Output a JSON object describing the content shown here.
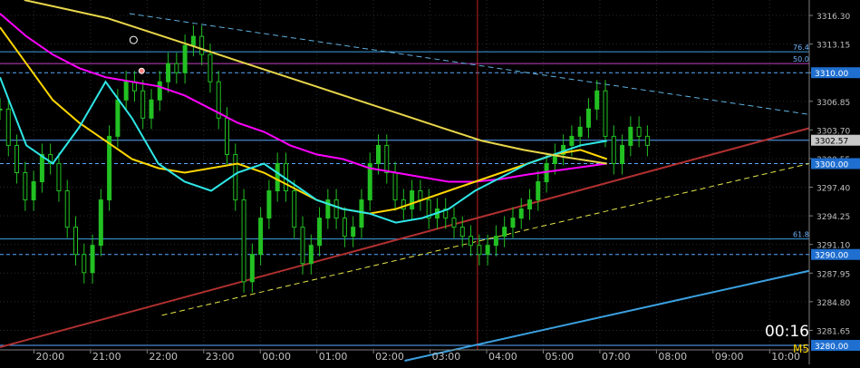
{
  "chart_data": {
    "type": "candlestick",
    "title": "",
    "xlabel": "",
    "ylabel": "",
    "x_ticks": [
      "20:00",
      "21:00",
      "22:00",
      "23:00",
      "00:00",
      "01:00",
      "02:00",
      "03:00",
      "04:00",
      "05:00",
      "07:00",
      "08:00",
      "09:00",
      "10:00"
    ],
    "y_ticks": [
      "3316.30",
      "3313.15",
      "3310.00",
      "3306.85",
      "3303.70",
      "3300.55",
      "3297.40",
      "3294.25",
      "3291.10",
      "3287.95",
      "3284.80",
      "3281.65"
    ],
    "ylim": [
      3279.5,
      3318.0
    ],
    "price_boxes": [
      {
        "label": "3310.00",
        "value": 3310.0
      },
      {
        "label": "3302.57",
        "value": 3302.57
      },
      {
        "label": "3300.00",
        "value": 3300.0
      },
      {
        "label": "3290.00",
        "value": 3290.0
      },
      {
        "label": "3280.00",
        "value": 3280.0
      }
    ],
    "fib_levels": [
      {
        "label": "76.4",
        "value": 3312.3
      },
      {
        "label": "50.0",
        "value": 3311.0
      },
      {
        "label": "61.8",
        "value": 3291.7
      }
    ],
    "close_series": [
      3306,
      3302,
      3299,
      3296,
      3298,
      3301,
      3300,
      3297,
      3293,
      3290,
      3288,
      3291,
      3296,
      3303,
      3307,
      3309,
      3308,
      3305,
      3307,
      3309,
      3311,
      3310,
      3313,
      3314,
      3312,
      3309,
      3305,
      3301,
      3296,
      3287,
      3290,
      3294,
      3297,
      3300,
      3297,
      3293,
      3289,
      3291,
      3294,
      3296,
      3294,
      3292,
      3293,
      3296,
      3300,
      3302,
      3299,
      3296,
      3295,
      3297,
      3296,
      3294,
      3295,
      3294,
      3293,
      3292,
      3291,
      3290,
      3291,
      3292,
      3293,
      3294,
      3295,
      3296,
      3298,
      3300,
      3301,
      3302,
      3303,
      3304,
      3306,
      3308,
      3303,
      3300,
      3302,
      3304,
      3303,
      3302
    ],
    "ma_series": [
      {
        "color": "#ff00ff",
        "values": [
          3316.5,
          3314,
          3312,
          3310.5,
          3309.5,
          3309,
          3308.5,
          3307.5,
          3306,
          3304.5,
          3303.5,
          3302,
          3301,
          3300.5,
          3299.5,
          3299,
          3298.5,
          3298,
          3298,
          3298.3,
          3298.8,
          3299.2,
          3299.6,
          3300
        ]
      },
      {
        "color": "#ffd700",
        "values": [
          3315,
          3311,
          3307,
          3304.5,
          3302.5,
          3300.5,
          3299.5,
          3299,
          3299.5,
          3300,
          3299,
          3297.5,
          3296,
          3295,
          3294.5,
          3295,
          3296,
          3297,
          3298,
          3299,
          3300,
          3301,
          3301.5,
          3300.5
        ]
      },
      {
        "color": "#2ee6e6",
        "values": [
          3309.5,
          3302,
          3300,
          3304,
          3309,
          3305,
          3300,
          3298,
          3297,
          3299,
          3300,
          3298,
          3296,
          3295,
          3294.5,
          3293.5,
          3294,
          3295,
          3297,
          3298.5,
          3300,
          3301,
          3302,
          3302.5
        ]
      },
      {
        "color": "#e8d64a",
        "values": [
          3318,
          3317,
          3316,
          3314.5,
          3313,
          3311.5,
          3310,
          3308.5,
          3307,
          3305.5,
          3304,
          3302.5,
          3301.5,
          3300.7,
          3300
        ]
      }
    ],
    "trendlines": [
      {
        "color": "#b03030",
        "from": {
          "x": 0,
          "y": 3279.8
        },
        "to": {
          "x": 1,
          "y": 3303.9
        }
      },
      {
        "color": "#3aa0e0",
        "from": {
          "x": 0.5,
          "y": 3278.3
        },
        "to": {
          "x": 1,
          "y": 3288.2
        }
      },
      {
        "color": "#e6e64a",
        "from": {
          "x": 0.2,
          "y": 3283.3
        },
        "to": {
          "x": 1,
          "y": 3300.0
        }
      },
      {
        "color": "#60b0e0",
        "from": {
          "x": 0.16,
          "y": 3316.5
        },
        "to": {
          "x": 1,
          "y": 3305.4
        }
      }
    ],
    "countdown": "00:16",
    "timeframe": "M5"
  }
}
